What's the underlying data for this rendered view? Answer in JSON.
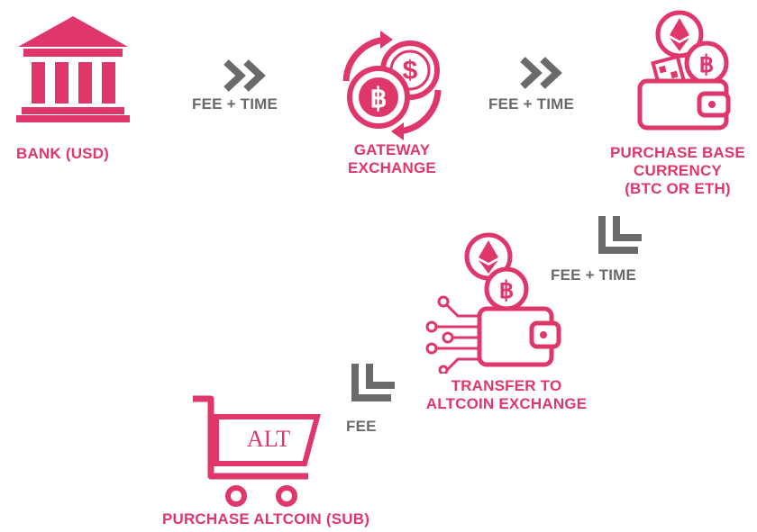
{
  "colors": {
    "accent": "#e0376b",
    "arrow": "#6a6a6a",
    "background": "#ffffff"
  },
  "nodes": [
    {
      "id": "bank",
      "label_lines": [
        "BANK (USD)"
      ],
      "icon": "bank-icon"
    },
    {
      "id": "gateway",
      "label_lines": [
        "GATEWAY",
        "EXCHANGE"
      ],
      "icon": "currency-exchange-icon"
    },
    {
      "id": "purchase_base",
      "label_lines": [
        "PURCHASE BASE",
        "CURRENCY",
        "(BTC OR ETH)"
      ],
      "icon": "crypto-wallet-icon"
    },
    {
      "id": "transfer",
      "label_lines": [
        "TRANSFER TO",
        "ALTCOIN EXCHANGE"
      ],
      "icon": "wallet-transfer-icon"
    },
    {
      "id": "purchase_altcoin",
      "label_lines": [
        "PURCHASE ALTCOIN (SUB)"
      ],
      "icon": "shopping-cart-icon",
      "cart_text": "ALT"
    }
  ],
  "edges": [
    {
      "from": "bank",
      "to": "gateway",
      "label": "FEE + TIME",
      "arrow": "double-chevron-right"
    },
    {
      "from": "gateway",
      "to": "purchase_base",
      "label": "FEE + TIME",
      "arrow": "double-chevron-right"
    },
    {
      "from": "purchase_base",
      "to": "transfer",
      "label": "FEE + TIME",
      "arrow": "double-chevron-down-left"
    },
    {
      "from": "transfer",
      "to": "purchase_altcoin",
      "label": "FEE",
      "arrow": "double-chevron-down-left"
    }
  ]
}
